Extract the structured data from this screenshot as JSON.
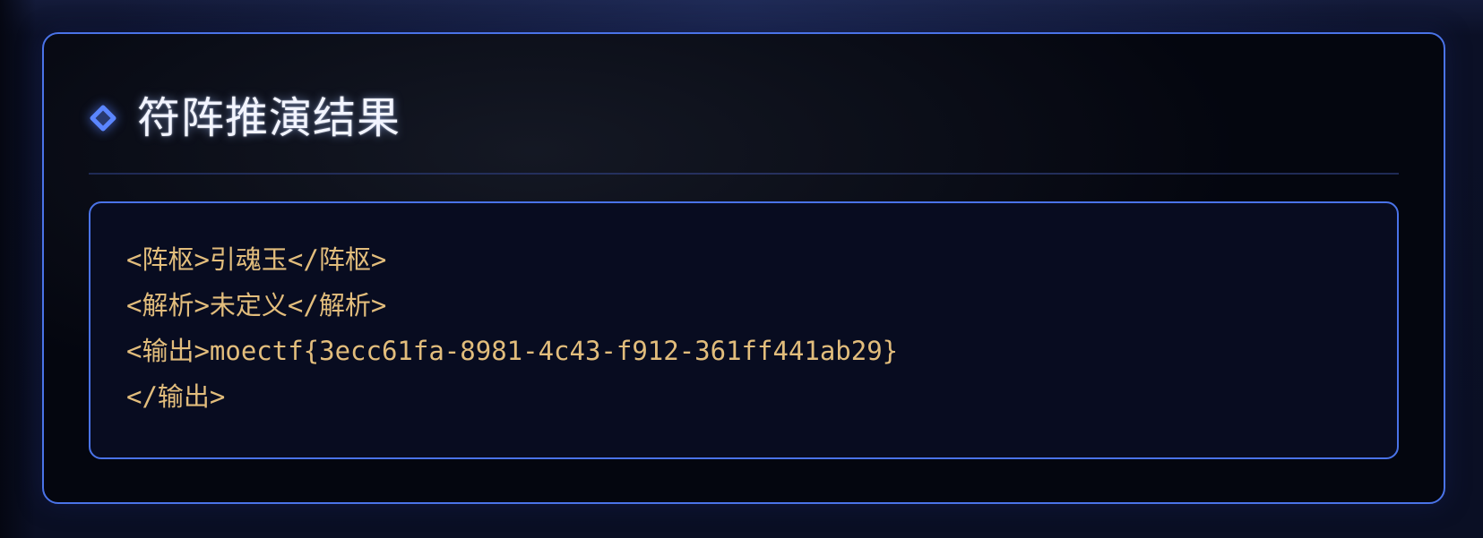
{
  "panel": {
    "title": "符阵推演结果",
    "icon": "diamond-icon"
  },
  "result": {
    "lines": [
      "<阵枢>引魂玉</阵枢>",
      "<解析>未定义</解析>",
      "<输出>moectf{3ecc61fa-8981-4c43-f912-361ff441ab29}",
      "</输出>"
    ]
  },
  "colors": {
    "accent": "#4a73e8",
    "code_text": "#e2bd7c",
    "title_text": "#f2f4ff",
    "panel_bg": "#04060f",
    "code_bg": "#080c20"
  }
}
